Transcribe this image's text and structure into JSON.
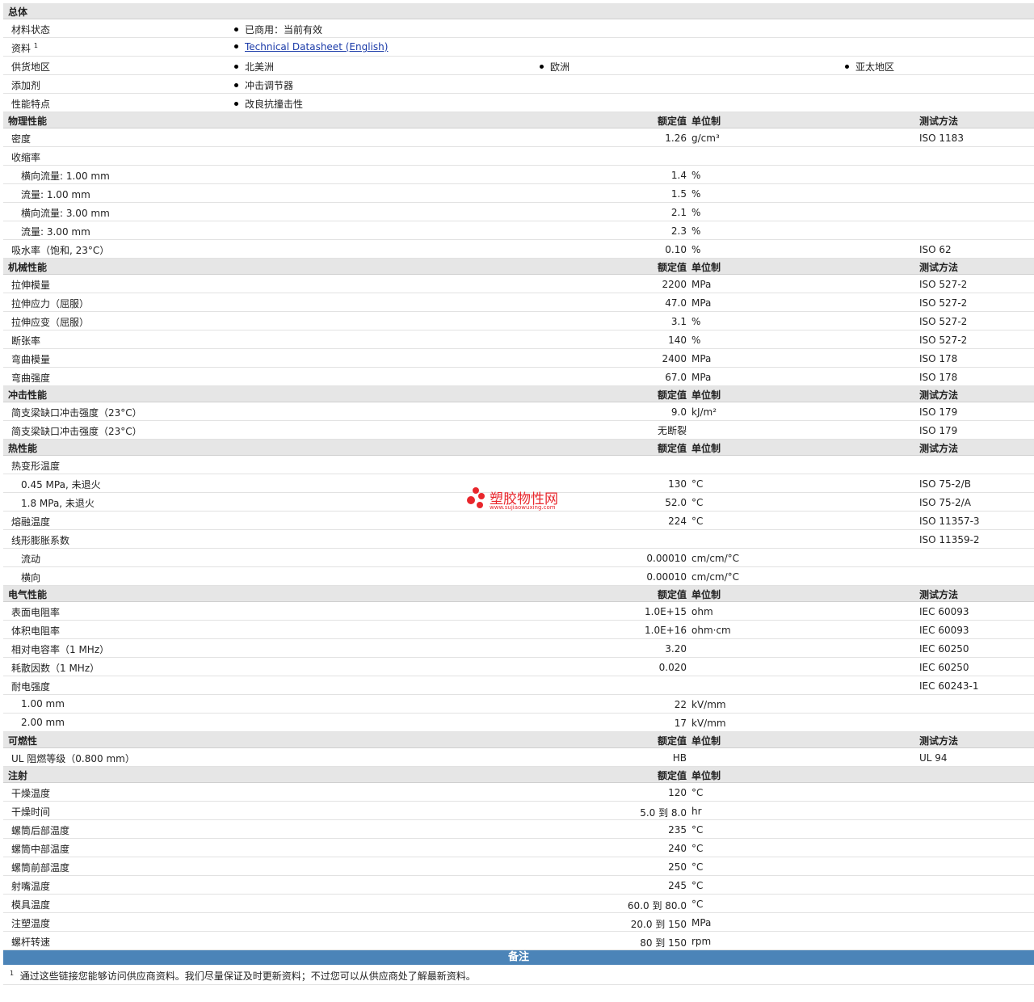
{
  "general": {
    "title": "总体",
    "rows": [
      {
        "label": "材料状态",
        "items": [
          "已商用：当前有效"
        ]
      },
      {
        "label": "资料",
        "sup": "1",
        "link": "Technical Datasheet (English)"
      },
      {
        "label": "供货地区",
        "items": [
          "北美洲",
          "欧洲",
          "亚太地区"
        ]
      },
      {
        "label": "添加剂",
        "items": [
          "冲击调节器"
        ]
      },
      {
        "label": "性能特点",
        "items": [
          "改良抗撞击性"
        ]
      }
    ]
  },
  "headers": {
    "value": "额定值",
    "unit": "单位制",
    "test": "测试方法"
  },
  "physical": {
    "title": "物理性能",
    "rows": [
      {
        "label": "密度",
        "value": "1.26",
        "unit": "g/cm³",
        "test": "ISO 1183"
      },
      {
        "label": "收缩率",
        "value": "",
        "unit": "",
        "test": ""
      },
      {
        "label": "横向流量: 1.00 mm",
        "value": "1.4",
        "unit": "%",
        "test": ""
      },
      {
        "label": "流量: 1.00 mm",
        "value": "1.5",
        "unit": "%",
        "test": ""
      },
      {
        "label": "横向流量: 3.00 mm",
        "value": "2.1",
        "unit": "%",
        "test": ""
      },
      {
        "label": "流量: 3.00 mm",
        "value": "2.3",
        "unit": "%",
        "test": ""
      },
      {
        "label": "吸水率（饱和, 23°C）",
        "value": "0.10",
        "unit": "%",
        "test": "ISO 62"
      }
    ]
  },
  "mechanical": {
    "title": "机械性能",
    "rows": [
      {
        "label": "拉伸模量",
        "value": "2200",
        "unit": "MPa",
        "test": "ISO 527-2"
      },
      {
        "label": "拉伸应力（屈服）",
        "value": "47.0",
        "unit": "MPa",
        "test": "ISO 527-2"
      },
      {
        "label": "拉伸应变（屈服）",
        "value": "3.1",
        "unit": "%",
        "test": "ISO 527-2"
      },
      {
        "label": "断张率",
        "value": "140",
        "unit": "%",
        "test": "ISO 527-2"
      },
      {
        "label": "弯曲模量",
        "value": "2400",
        "unit": "MPa",
        "test": "ISO 178"
      },
      {
        "label": "弯曲强度",
        "value": "67.0",
        "unit": "MPa",
        "test": "ISO 178"
      }
    ]
  },
  "impact": {
    "title": "冲击性能",
    "rows": [
      {
        "label": "简支梁缺口冲击强度（23°C）",
        "value": "9.0",
        "unit": "kJ/m²",
        "test": "ISO 179"
      },
      {
        "label": "简支梁缺口冲击强度（23°C）",
        "value": "无断裂",
        "unit": "",
        "test": "ISO 179"
      }
    ]
  },
  "thermal": {
    "title": "热性能",
    "rows": [
      {
        "label": "热变形温度",
        "value": "",
        "unit": "",
        "test": ""
      },
      {
        "label": "0.45 MPa, 未退火",
        "value": "130",
        "unit": "°C",
        "test": "ISO 75-2/B"
      },
      {
        "label": "1.8 MPa, 未退火",
        "value": "52.0",
        "unit": "°C",
        "test": "ISO 75-2/A"
      },
      {
        "label": "熔融温度",
        "value": "224",
        "unit": "°C",
        "test": "ISO 11357-3"
      },
      {
        "label": "线形膨胀系数",
        "value": "",
        "unit": "",
        "test": "ISO 11359-2"
      },
      {
        "label": "流动",
        "value": "0.00010",
        "unit": "cm/cm/°C",
        "test": ""
      },
      {
        "label": "横向",
        "value": "0.00010",
        "unit": "cm/cm/°C",
        "test": ""
      }
    ]
  },
  "electrical": {
    "title": "电气性能",
    "rows": [
      {
        "label": "表面电阻率",
        "value": "1.0E+15",
        "unit": "ohm",
        "test": "IEC 60093"
      },
      {
        "label": "体积电阻率",
        "value": "1.0E+16",
        "unit": "ohm·cm",
        "test": "IEC 60093"
      },
      {
        "label": "相对电容率（1 MHz）",
        "value": "3.20",
        "unit": "",
        "test": "IEC 60250"
      },
      {
        "label": "耗散因数（1 MHz）",
        "value": "0.020",
        "unit": "",
        "test": "IEC 60250"
      },
      {
        "label": "耐电强度",
        "value": "",
        "unit": "",
        "test": "IEC 60243-1"
      },
      {
        "label": "1.00 mm",
        "value": "22",
        "unit": "kV/mm",
        "test": ""
      },
      {
        "label": "2.00 mm",
        "value": "17",
        "unit": "kV/mm",
        "test": ""
      }
    ]
  },
  "flammability": {
    "title": "可燃性",
    "rows": [
      {
        "label": "UL 阻燃等级（0.800 mm）",
        "value": "HB",
        "unit": "",
        "test": "UL 94"
      }
    ]
  },
  "injection": {
    "title": "注射",
    "rows": [
      {
        "label": "干燥温度",
        "value": "120",
        "unit": "°C"
      },
      {
        "label": "干燥时间",
        "value": "5.0 到  8.0",
        "unit": "hr"
      },
      {
        "label": "螺筒后部温度",
        "value": "235",
        "unit": "°C"
      },
      {
        "label": "螺筒中部温度",
        "value": "240",
        "unit": "°C"
      },
      {
        "label": "螺筒前部温度",
        "value": "250",
        "unit": "°C"
      },
      {
        "label": "射嘴温度",
        "value": "245",
        "unit": "°C"
      },
      {
        "label": "模具温度",
        "value": "60.0 到  80.0",
        "unit": "°C"
      },
      {
        "label": "注塑温度",
        "value": "20.0 到  150",
        "unit": "MPa"
      },
      {
        "label": "螺杆转速",
        "value": "80 到  150",
        "unit": "rpm"
      }
    ]
  },
  "notes": {
    "title": "备注",
    "sup": "1",
    "text": "通过这些链接您能够访问供应商资料。我们尽量保证及时更新资料；不过您可以从供应商处了解最新资料。"
  },
  "watermark": {
    "name": "塑胶物性网",
    "url": "www.sujiaowuxing.com"
  },
  "colors": {
    "header_bg": "#e6e6e6",
    "notes_bar": "#4b84b8",
    "link": "#1a3aa8",
    "watermark": "#e8262c"
  }
}
